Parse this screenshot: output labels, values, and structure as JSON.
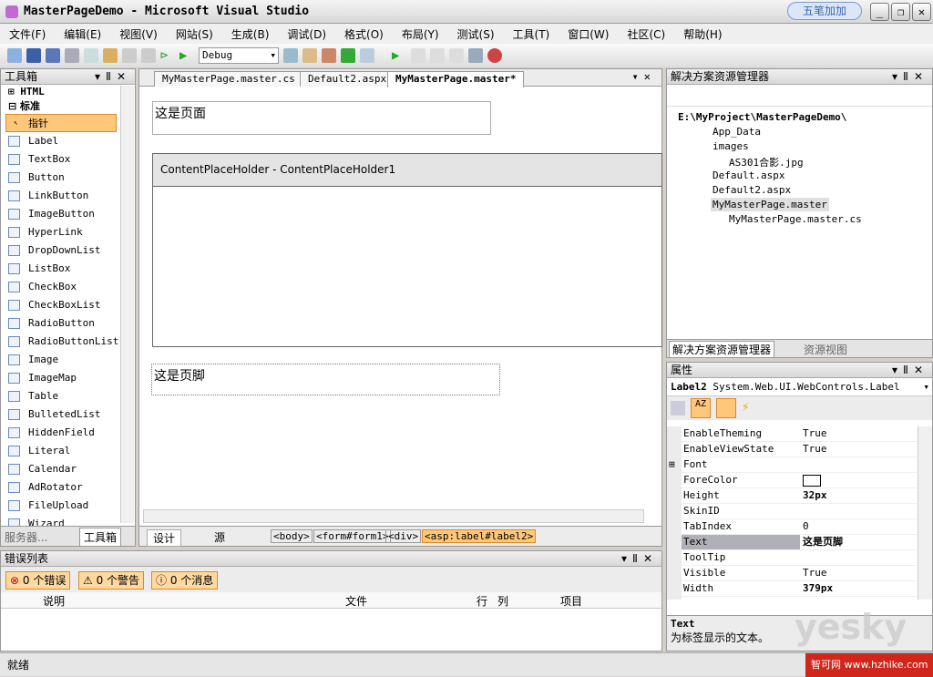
{
  "window": {
    "title": "MasterPageDemo - Microsoft Visual Studio",
    "badge": "五笔加加"
  },
  "menu": [
    "文件(F)",
    "编辑(E)",
    "视图(V)",
    "网站(S)",
    "生成(B)",
    "调试(D)",
    "格式(O)",
    "布局(Y)",
    "测试(S)",
    "工具(T)",
    "窗口(W)",
    "社区(C)",
    "帮助(H)"
  ],
  "toolbar": {
    "config": "Debug"
  },
  "toolbox": {
    "title": "工具箱",
    "groups": [
      "HTML",
      "标准"
    ],
    "items": [
      "指针",
      "Label",
      "TextBox",
      "Button",
      "LinkButton",
      "ImageButton",
      "HyperLink",
      "DropDownList",
      "ListBox",
      "CheckBox",
      "CheckBoxList",
      "RadioButton",
      "RadioButtonList",
      "Image",
      "ImageMap",
      "Table",
      "BulletedList",
      "HiddenField",
      "Literal",
      "Calendar",
      "AdRotator",
      "FileUpload",
      "Wizard"
    ],
    "bottom_tabs": [
      "服务器...",
      "工具箱"
    ]
  },
  "editor": {
    "tabs": [
      "MyMasterPage.master.cs",
      "Default2.aspx",
      "MyMasterPage.master*"
    ],
    "header_text": "这是页面",
    "placeholder_label": "ContentPlaceHolder - ContentPlaceHolder1",
    "footer_text": "这是页脚",
    "view_tabs": [
      "设计",
      "源"
    ],
    "breadcrumb": [
      "<body>",
      "<form#form1>",
      "<div>",
      "<asp:label#label2>"
    ]
  },
  "solution": {
    "title": "解决方案资源管理器",
    "items": [
      "E:\\MyProject\\MasterPageDemo\\",
      "App_Data",
      "images",
      "AS301合影.jpg",
      "Default.aspx",
      "Default2.aspx",
      "MyMasterPage.master",
      "MyMasterPage.master.cs"
    ],
    "tabs": [
      "解决方案资源管理器",
      "资源视图"
    ]
  },
  "properties": {
    "title": "属性",
    "object": "Label2",
    "object_type": "System.Web.UI.WebControls.Label",
    "rows": [
      {
        "name": "EnableTheming",
        "value": "True"
      },
      {
        "name": "EnableViewState",
        "value": "True"
      },
      {
        "name": "Font",
        "value": ""
      },
      {
        "name": "ForeColor",
        "value": ""
      },
      {
        "name": "Height",
        "value": "32px"
      },
      {
        "name": "SkinID",
        "value": ""
      },
      {
        "name": "TabIndex",
        "value": "0"
      },
      {
        "name": "Text",
        "value": "这是页脚"
      },
      {
        "name": "ToolTip",
        "value": ""
      },
      {
        "name": "Visible",
        "value": "True"
      },
      {
        "name": "Width",
        "value": "379px"
      }
    ],
    "desc_title": "Text",
    "desc": "为标签显示的文本。"
  },
  "errors": {
    "title": "错误列表",
    "buttons": [
      "0 个错误",
      "0 个警告",
      "0 个消息"
    ],
    "columns": [
      "说明",
      "文件",
      "行",
      "列",
      "项目"
    ]
  },
  "status": {
    "text": "就绪"
  },
  "watermark": {
    "logo": "yesky 天极网",
    "corner": "智可网 www.hzhike.com"
  }
}
